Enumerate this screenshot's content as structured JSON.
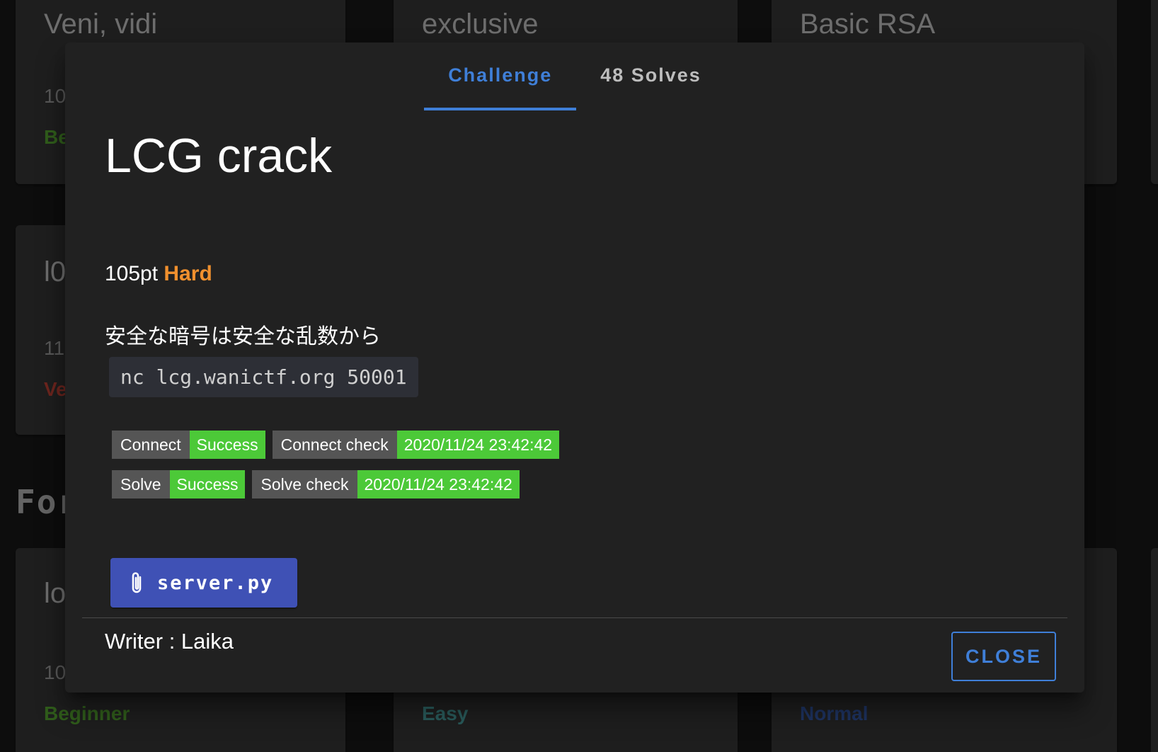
{
  "background": {
    "cards": [
      {
        "title": "Veni, vidi",
        "points": "10",
        "difficulty": "Be",
        "difficulty_color": "#4a8f2a"
      },
      {
        "title": "exclusive",
        "points": "",
        "difficulty": "",
        "difficulty_color": ""
      },
      {
        "title": "Basic RSA",
        "points": "",
        "difficulty": "",
        "difficulty_color": ""
      },
      {
        "title": "l0",
        "points": "11",
        "difficulty": "Ve",
        "difficulty_color": "#a83a2e"
      },
      {
        "title": "lo",
        "points": "10",
        "difficulty": "Beginner",
        "difficulty_color": "#4a8f2a"
      },
      {
        "title": "",
        "points": "",
        "difficulty": "Easy",
        "difficulty_color": "#3f8a8a"
      },
      {
        "title": "",
        "points": "",
        "difficulty": "Normal",
        "difficulty_color": "#2f4f95"
      }
    ],
    "section_heading": "For"
  },
  "dialog": {
    "tabs": [
      {
        "label": "Challenge",
        "active": true
      },
      {
        "label": "48 Solves",
        "active": false
      }
    ],
    "title": "LCG crack",
    "points": "105pt",
    "difficulty": "Hard",
    "difficulty_color": "#f0902e",
    "description": "安全な暗号は安全な乱数から",
    "command": "nc lcg.wanictf.org 50001",
    "badges": [
      [
        {
          "label": "Connect",
          "value": "Success"
        },
        {
          "label": "Connect check",
          "value": "2020/11/24 23:42:42"
        }
      ],
      [
        {
          "label": "Solve",
          "value": "Success"
        },
        {
          "label": "Solve check",
          "value": "2020/11/24 23:42:42"
        }
      ]
    ],
    "file_button": {
      "label": "server.py",
      "icon": "paperclip-icon"
    },
    "writer": "Writer : Laika",
    "close_label": "CLOSE"
  },
  "colors": {
    "accent": "#3f7fd8",
    "file_button": "#3f51b5",
    "badge_success": "#4cc938",
    "badge_label": "#555555",
    "dialog_bg": "#212121"
  }
}
